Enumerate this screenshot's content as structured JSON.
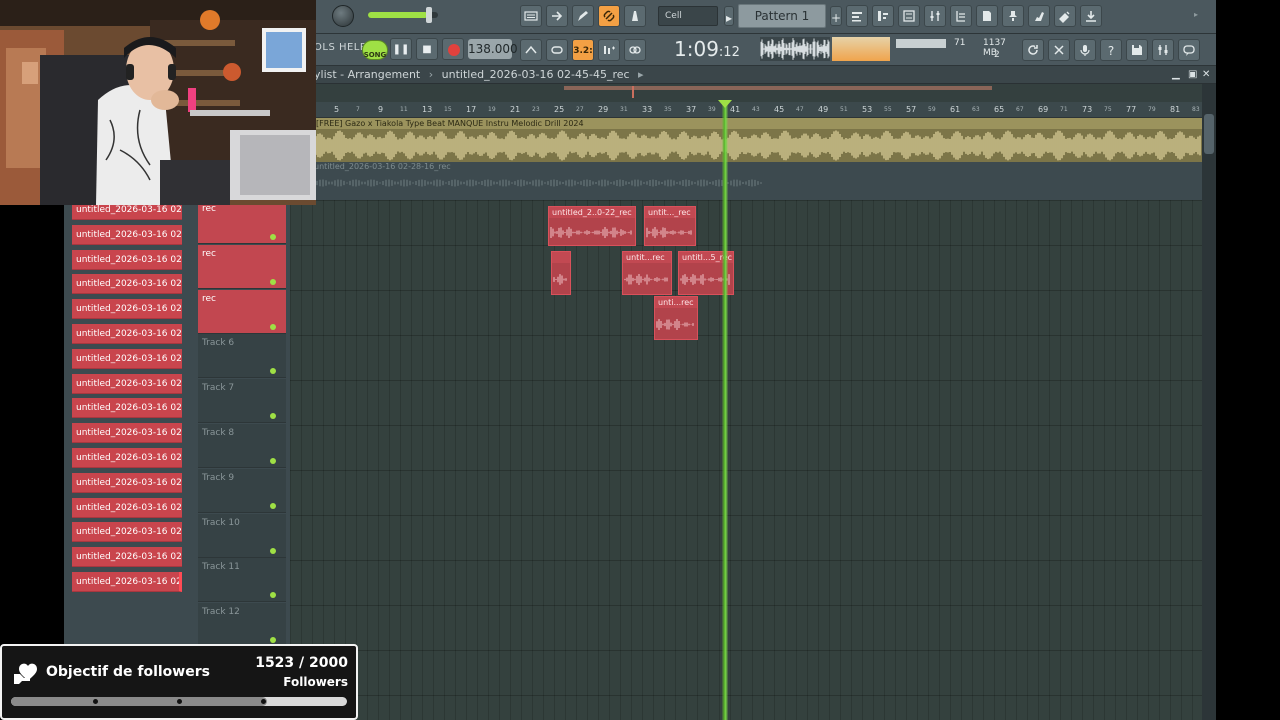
{
  "toolbar": {
    "snap_value": "Cell",
    "pattern_label": "Pattern 1",
    "menu_tail": "OLS HELP",
    "song_mode_label": "SONG",
    "tempo": "138.000",
    "time_main": "1:09",
    "time_sub": ":12",
    "cpu_value": "71",
    "memory_value": "1137 MB",
    "voices_value": "2"
  },
  "playlist": {
    "window_title": "ylist - Arrangement",
    "breadcrumb_arrangement": "untitled_2026-03-16 02-45-45_rec",
    "ruler_major": [
      "5",
      "9",
      "13",
      "17",
      "21",
      "25",
      "29",
      "33",
      "37",
      "41",
      "45",
      "49",
      "53",
      "57",
      "61",
      "65",
      "69",
      "73",
      "77",
      "81"
    ],
    "ruler_minor": [
      "7",
      "11",
      "15",
      "19",
      "23",
      "27",
      "31",
      "35",
      "39",
      "43",
      "47",
      "51",
      "55",
      "59",
      "63",
      "67",
      "71",
      "75",
      "79",
      "83"
    ],
    "audio_track_title": "[FREE] Gazo x Tiakola Type Beat MANQUE  Instru Melodic Drill 2024",
    "ghost_clip_title": "untitled_2026-03-16 02-28-16_rec"
  },
  "picker": {
    "items": [
      "untitled_2026-03-16 02...",
      "untitled_2026-03-16 02...",
      "untitled_2026-03-16 02...",
      "untitled_2026-03-16 02...",
      "untitled_2026-03-16 02...",
      "untitled_2026-03-16 02...",
      "untitled_2026-03-16 02...",
      "untitled_2026-03-16 02...",
      "untitled_2026-03-16 02...",
      "untitled_2026-03-16 02...",
      "untitled_2026-03-16 02...",
      "untitled_2026-03-16 02...",
      "untitled_2026-03-16 02...",
      "untitled_2026-03-16 02...",
      "untitled_2026-03-16 02...",
      "untitled_2026-03-16 02..."
    ]
  },
  "tracks": [
    {
      "name": "rec"
    },
    {
      "name": "rec"
    },
    {
      "name": "rec"
    },
    {
      "name": "Track 6"
    },
    {
      "name": "Track 7"
    },
    {
      "name": "Track 8"
    },
    {
      "name": "Track 9"
    },
    {
      "name": "Track 10"
    },
    {
      "name": "Track 11"
    },
    {
      "name": "Track 12"
    }
  ],
  "clips": [
    {
      "label": "untitled_2..0-22_rec"
    },
    {
      "label": "untit..._rec"
    },
    {
      "label": ""
    },
    {
      "label": "untit...rec"
    },
    {
      "label": "untitl...5_rec"
    },
    {
      "label": "unti...rec"
    }
  ],
  "goal": {
    "title": "Objectif de followers",
    "count": "1523 / 2000",
    "unit": "Followers",
    "current": 1523,
    "target": 2000
  },
  "colors": {
    "accent_green": "#9fe045",
    "clip_red": "#c24952",
    "audio_clip": "#9b935d",
    "orange_active": "#f3a044"
  }
}
